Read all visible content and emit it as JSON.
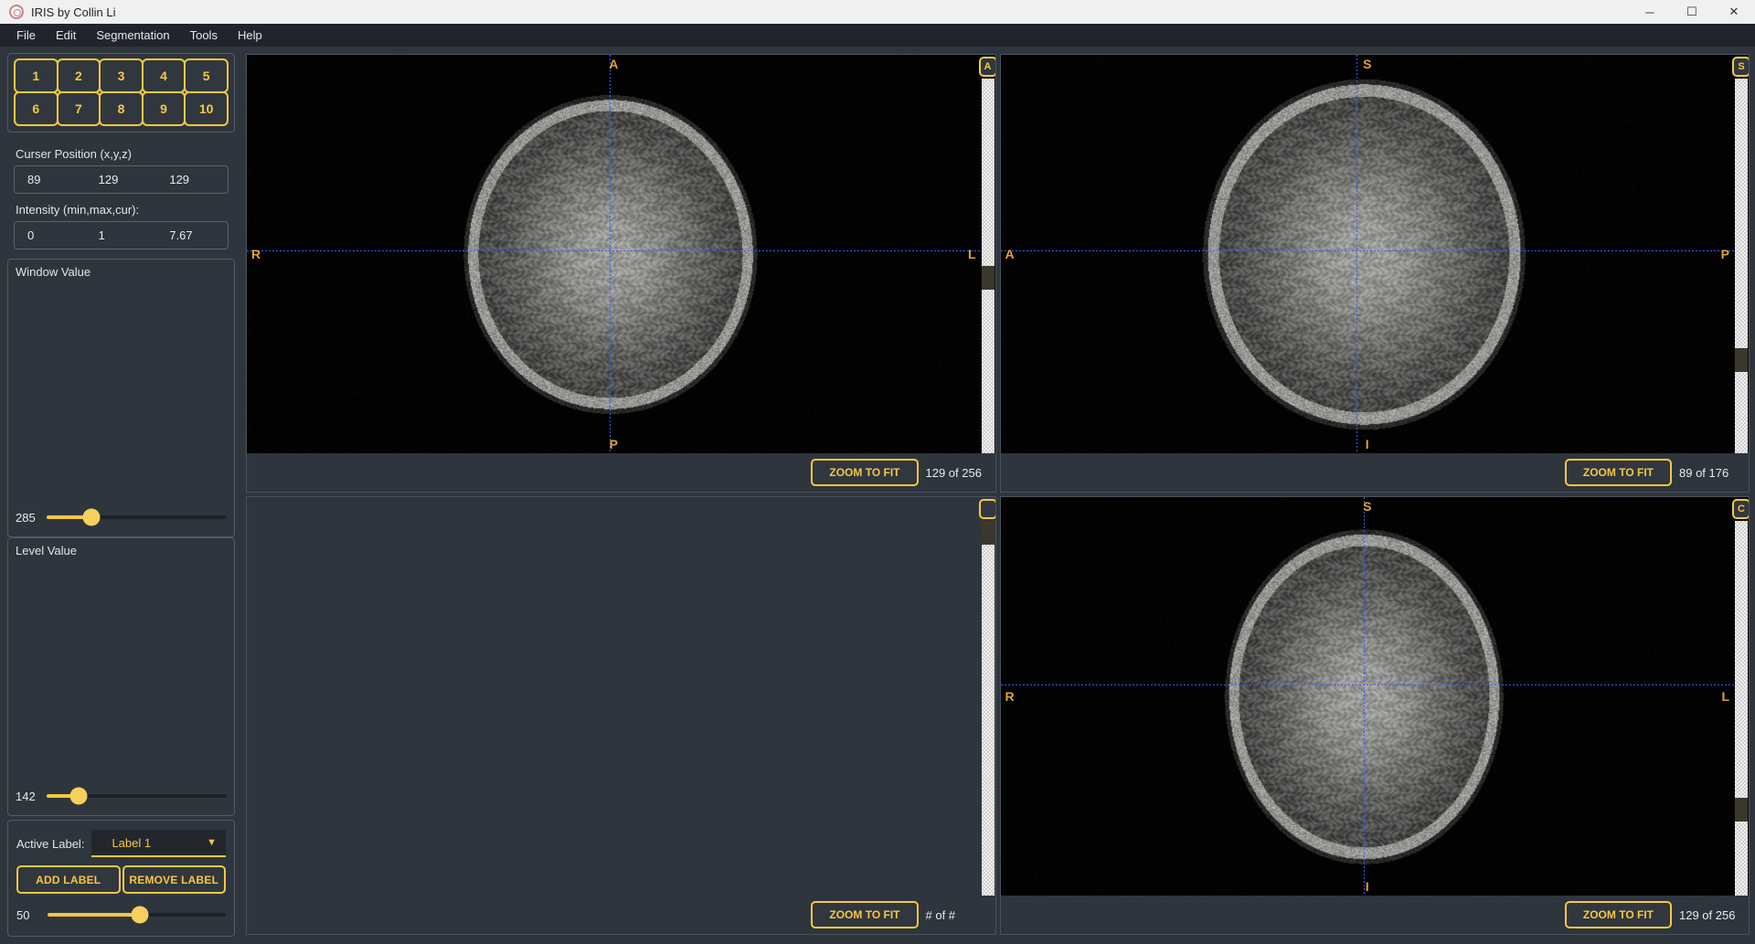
{
  "window": {
    "title": "IRIS by Collin Li",
    "app_icon": "iris-logo-icon",
    "minimize": "─",
    "maximize": "☐",
    "close": "✕"
  },
  "menubar": {
    "items": [
      {
        "label": "File"
      },
      {
        "label": "Edit"
      },
      {
        "label": "Segmentation"
      },
      {
        "label": "Tools"
      },
      {
        "label": "Help"
      }
    ]
  },
  "sidebar": {
    "label_buttons": [
      [
        "1",
        "2",
        "3",
        "4",
        "5"
      ],
      [
        "6",
        "7",
        "8",
        "9",
        "10"
      ]
    ],
    "cursor": {
      "label": "Curser Position (x,y,z)",
      "x": "89",
      "y": "129",
      "z": "129"
    },
    "intensity": {
      "label": "Intensity (min,max,cur):",
      "min": "0",
      "max": "1",
      "cur": "7.67"
    },
    "window_slider": {
      "title": "Window Value",
      "value": "285",
      "percent": 25
    },
    "level_slider": {
      "title": "Level Value",
      "value": "142",
      "percent": 18
    },
    "label_control": {
      "active_label_caption": "Active Label:",
      "active_label_value": "Label 1",
      "dropdown_arrow": "▼",
      "add_label": "ADD LABEL",
      "remove_label": "REMOVE LABEL",
      "opacity_value": "50",
      "opacity_percent": 52
    }
  },
  "views": [
    {
      "name": "axial",
      "orientation": {
        "top": "A",
        "bottom": "P",
        "left": "R",
        "right": "L"
      },
      "scroll_toggle": "A",
      "scroll_thumb_percent": 50,
      "zoom_to_fit": "ZOOM TO FIT",
      "slice_count": "129 of 256",
      "empty": false,
      "crosshair": {
        "x_percent": 49.5,
        "y_percent": 49
      }
    },
    {
      "name": "sagittal",
      "orientation": {
        "top": "S",
        "bottom": "I",
        "left": "A",
        "right": "P"
      },
      "scroll_toggle": "S",
      "scroll_thumb_percent": 72,
      "zoom_to_fit": "ZOOM TO FIT",
      "slice_count": "89 of 176",
      "empty": false,
      "crosshair": {
        "x_percent": 48.5,
        "y_percent": 49
      }
    },
    {
      "name": "3d-empty",
      "orientation": {
        "top": "",
        "bottom": "",
        "left": "",
        "right": ""
      },
      "scroll_toggle": "",
      "scroll_thumb_percent": 12,
      "zoom_to_fit": "ZOOM TO FIT",
      "slice_count": "# of #",
      "empty": true,
      "crosshair": null
    },
    {
      "name": "coronal",
      "orientation": {
        "top": "S",
        "bottom": "I",
        "left": "R",
        "right": "L"
      },
      "scroll_toggle": "C",
      "scroll_thumb_percent": 74,
      "zoom_to_fit": "ZOOM TO FIT",
      "slice_count": "129 of 256",
      "empty": false,
      "crosshair": {
        "x_percent": 49.5,
        "y_percent": 47
      }
    }
  ],
  "colors": {
    "accent": "#f5c842",
    "orient_text": "#e0a32e",
    "crosshair": "#3b5cff",
    "panel_bg": "#2f353c",
    "menu_bg": "#21252b"
  }
}
